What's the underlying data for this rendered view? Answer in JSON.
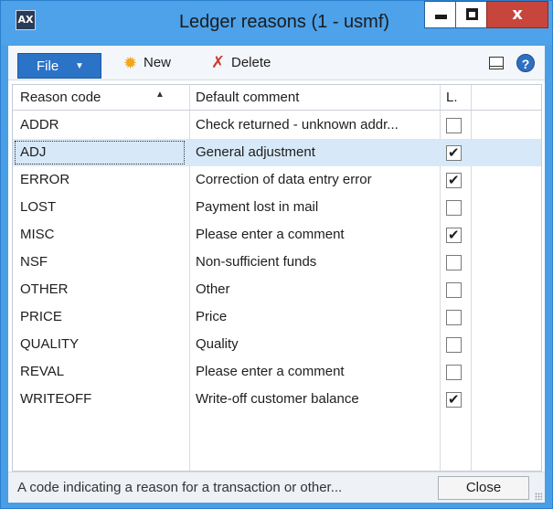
{
  "window": {
    "title": "Ledger reasons (1 - usmf)",
    "icon_label": "AX",
    "close_glyph": "x"
  },
  "toolbar": {
    "file_label": "File",
    "new_label": "New",
    "delete_label": "Delete",
    "help_glyph": "?"
  },
  "grid": {
    "columns": [
      "Reason code",
      "Default comment",
      "L."
    ],
    "sort_column": "Reason code",
    "sort_direction": "ascending",
    "rows": [
      {
        "code": "ADDR",
        "comment": "Check returned - unknown addr...",
        "checked": false
      },
      {
        "code": "ADJ",
        "comment": "General adjustment",
        "checked": true
      },
      {
        "code": "ERROR",
        "comment": "Correction of data entry error",
        "checked": true
      },
      {
        "code": "LOST",
        "comment": "Payment lost in mail",
        "checked": false
      },
      {
        "code": "MISC",
        "comment": "Please enter a comment",
        "checked": true
      },
      {
        "code": "NSF",
        "comment": "Non-sufficient funds",
        "checked": false
      },
      {
        "code": "OTHER",
        "comment": "Other",
        "checked": false
      },
      {
        "code": "PRICE",
        "comment": "Price",
        "checked": false
      },
      {
        "code": "QUALITY",
        "comment": "Quality",
        "checked": false
      },
      {
        "code": "REVAL",
        "comment": "Please enter a comment",
        "checked": false
      },
      {
        "code": "WRITEOFF",
        "comment": "Write-off customer balance",
        "checked": true
      }
    ],
    "selected_code": "ADJ"
  },
  "status": {
    "text": "A code indicating a reason for a transaction or other...",
    "close_label": "Close"
  },
  "colors": {
    "titlebar": "#4da2ea",
    "file_button": "#2b73c7",
    "selected_row": "#d7e9f8",
    "close_window": "#c7453a"
  }
}
